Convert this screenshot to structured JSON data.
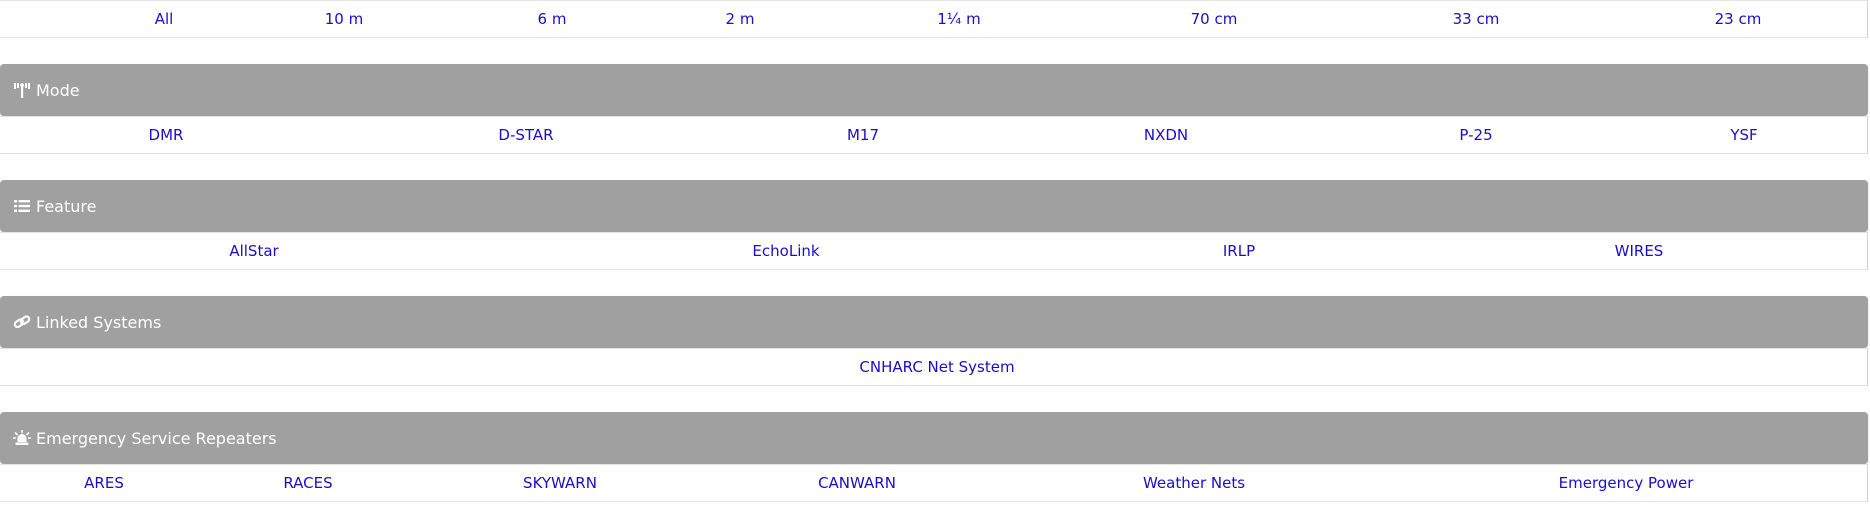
{
  "band_row": {
    "links": [
      "All",
      "10 m",
      "6 m",
      "2 m",
      "1¼ m",
      "70 cm",
      "33 cm",
      "23 cm"
    ]
  },
  "sections": [
    {
      "title": "Mode",
      "icon": "antenna-icon",
      "links": [
        "DMR",
        "D-STAR",
        "M17",
        "NXDN",
        "P-25",
        "YSF"
      ]
    },
    {
      "title": "Feature",
      "icon": "list-icon",
      "links": [
        "AllStar",
        "EchoLink",
        "IRLP",
        "WIRES"
      ]
    },
    {
      "title": "Linked Systems",
      "icon": "link-icon",
      "links": [
        "CNHARC Net System"
      ]
    },
    {
      "title": "Emergency Service Repeaters",
      "icon": "siren-icon",
      "links": [
        "ARES",
        "RACES",
        "SKYWARN",
        "CANWARN",
        "Weather Nets",
        "Emergency Power"
      ]
    }
  ],
  "colors": {
    "header_bg": "#a0a0a0",
    "header_text": "#ffffff",
    "link": "#1a0dcc"
  }
}
